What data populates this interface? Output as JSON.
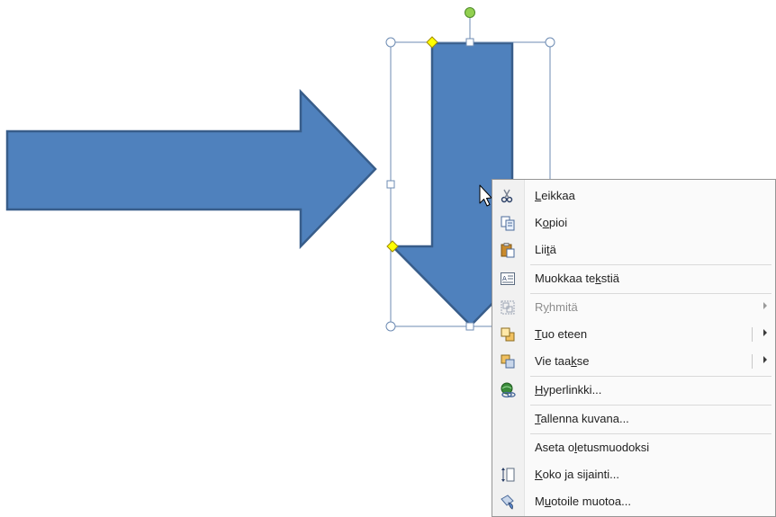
{
  "context_menu": {
    "items": [
      {
        "pre": "",
        "acc": "L",
        "post": "eikkaa",
        "icon": "cut-icon",
        "enabled": true,
        "submenu": false
      },
      {
        "pre": "K",
        "acc": "o",
        "post": "pioi",
        "icon": "copy-icon",
        "enabled": true,
        "submenu": false
      },
      {
        "pre": "Lii",
        "acc": "t",
        "post": "ä",
        "icon": "paste-icon",
        "enabled": true,
        "submenu": false
      },
      {
        "pre": "Muokkaa te",
        "acc": "k",
        "post": "stiä",
        "icon": "edit-text-icon",
        "enabled": true,
        "submenu": false
      },
      {
        "pre": "R",
        "acc": "y",
        "post": "hmitä",
        "icon": "group-icon",
        "enabled": false,
        "submenu": true
      },
      {
        "pre": "",
        "acc": "T",
        "post": "uo eteen",
        "icon": "bring-forward-icon",
        "enabled": true,
        "submenu": true
      },
      {
        "pre": "Vie taa",
        "acc": "k",
        "post": "se",
        "icon": "send-backward-icon",
        "enabled": true,
        "submenu": true
      },
      {
        "pre": "",
        "acc": "H",
        "post": "yperlinkki...",
        "icon": "hyperlink-icon",
        "enabled": true,
        "submenu": false
      },
      {
        "pre": "",
        "acc": "T",
        "post": "allenna kuvana...",
        "icon": "",
        "enabled": true,
        "submenu": false
      },
      {
        "pre": "Aseta o",
        "acc": "l",
        "post": "etusmuodoksi",
        "icon": "",
        "enabled": true,
        "submenu": false
      },
      {
        "pre": "",
        "acc": "K",
        "post": "oko ja sijainti...",
        "icon": "size-position-icon",
        "enabled": true,
        "submenu": false
      },
      {
        "pre": "M",
        "acc": "u",
        "post": "otoile muotoa...",
        "icon": "format-shape-icon",
        "enabled": true,
        "submenu": false
      }
    ]
  },
  "colors": {
    "shape_fill": "#4f81bd",
    "shape_stroke": "#385d8a",
    "selection_handle": "#ffffff",
    "adjust_handle": "#ffff00",
    "rotate_handle": "#92d050"
  }
}
